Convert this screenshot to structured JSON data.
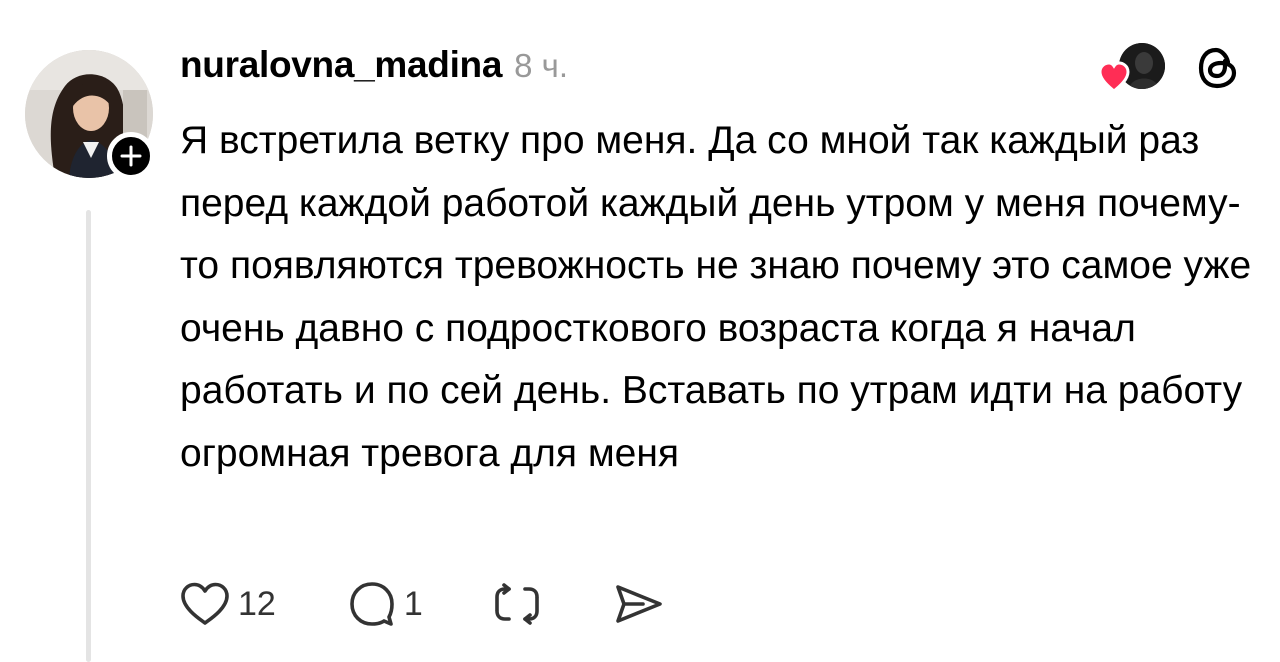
{
  "post": {
    "username": "nuralovna_madina",
    "timestamp": "8 ч.",
    "text": "Я встретила ветку про меня. Да со мной так каждый раз перед каждой работой каждый день утром у меня почему-то появляются тревожность не знаю почему это самое уже очень давно с подросткового возраста когда я начал работать и по сей день. Вставать по утрам идти на работу огромная тревога для меня",
    "likes_count": "12",
    "replies_count": "1"
  },
  "icons": {
    "follow": "plus-icon",
    "liked_by": "heart-icon",
    "app": "threads-logo-icon",
    "like": "heart-outline-icon",
    "reply": "comment-bubble-icon",
    "repost": "repost-icon",
    "share": "send-icon"
  },
  "colors": {
    "liked_heart": "#ff2d55",
    "muted_text": "#999999",
    "thread_line": "#e4e4e4"
  }
}
